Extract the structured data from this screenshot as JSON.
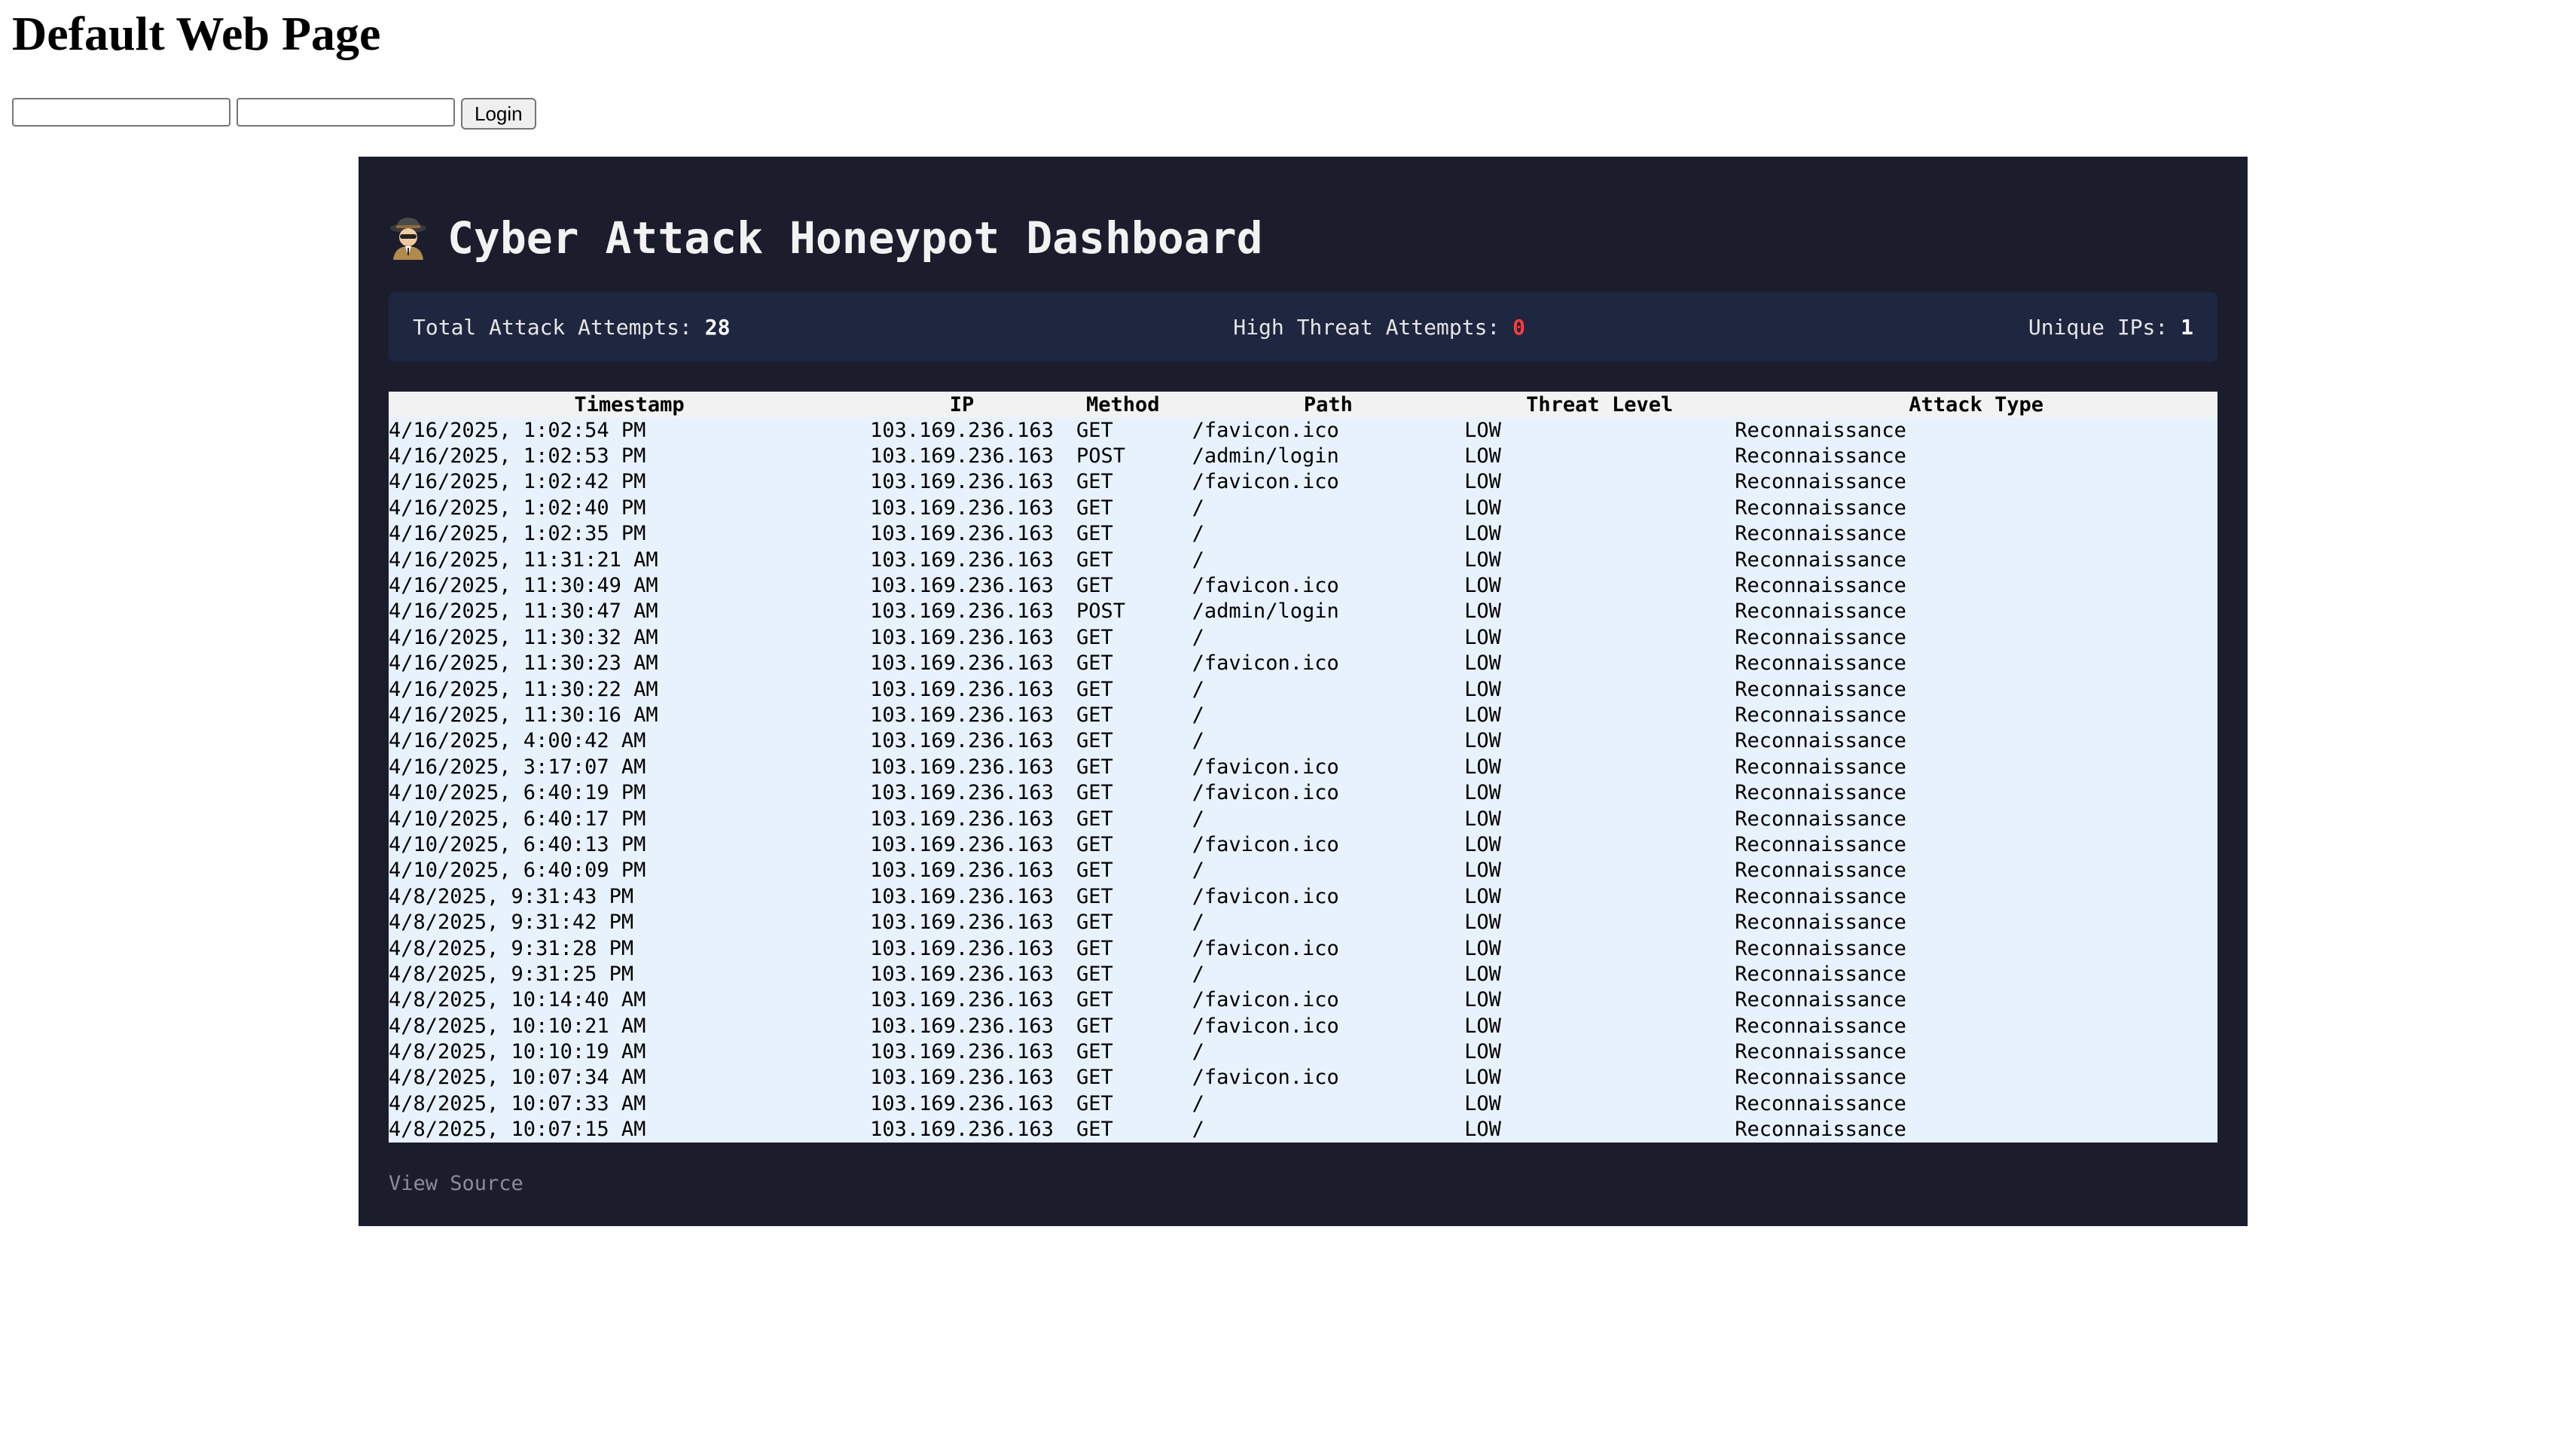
{
  "page": {
    "heading": "Default Web Page",
    "login": {
      "username_value": "",
      "password_value": "",
      "button_label": "Login"
    }
  },
  "dashboard": {
    "title": "Cyber Attack Honeypot Dashboard",
    "title_icon": "spy-icon",
    "stats": {
      "total_label": "Total Attack Attempts:",
      "total_value": "28",
      "high_label": "High Threat Attempts:",
      "high_value": "0",
      "unique_label": "Unique IPs:",
      "unique_value": "1"
    },
    "columns": [
      "Timestamp",
      "IP",
      "Method",
      "Path",
      "Threat Level",
      "Attack Type"
    ],
    "rows": [
      [
        "4/16/2025, 1:02:54 PM",
        "103.169.236.163",
        "GET",
        "/favicon.ico",
        "LOW",
        "Reconnaissance"
      ],
      [
        "4/16/2025, 1:02:53 PM",
        "103.169.236.163",
        "POST",
        "/admin/login",
        "LOW",
        "Reconnaissance"
      ],
      [
        "4/16/2025, 1:02:42 PM",
        "103.169.236.163",
        "GET",
        "/favicon.ico",
        "LOW",
        "Reconnaissance"
      ],
      [
        "4/16/2025, 1:02:40 PM",
        "103.169.236.163",
        "GET",
        "/",
        "LOW",
        "Reconnaissance"
      ],
      [
        "4/16/2025, 1:02:35 PM",
        "103.169.236.163",
        "GET",
        "/",
        "LOW",
        "Reconnaissance"
      ],
      [
        "4/16/2025, 11:31:21 AM",
        "103.169.236.163",
        "GET",
        "/",
        "LOW",
        "Reconnaissance"
      ],
      [
        "4/16/2025, 11:30:49 AM",
        "103.169.236.163",
        "GET",
        "/favicon.ico",
        "LOW",
        "Reconnaissance"
      ],
      [
        "4/16/2025, 11:30:47 AM",
        "103.169.236.163",
        "POST",
        "/admin/login",
        "LOW",
        "Reconnaissance"
      ],
      [
        "4/16/2025, 11:30:32 AM",
        "103.169.236.163",
        "GET",
        "/",
        "LOW",
        "Reconnaissance"
      ],
      [
        "4/16/2025, 11:30:23 AM",
        "103.169.236.163",
        "GET",
        "/favicon.ico",
        "LOW",
        "Reconnaissance"
      ],
      [
        "4/16/2025, 11:30:22 AM",
        "103.169.236.163",
        "GET",
        "/",
        "LOW",
        "Reconnaissance"
      ],
      [
        "4/16/2025, 11:30:16 AM",
        "103.169.236.163",
        "GET",
        "/",
        "LOW",
        "Reconnaissance"
      ],
      [
        "4/16/2025, 4:00:42 AM",
        "103.169.236.163",
        "GET",
        "/",
        "LOW",
        "Reconnaissance"
      ],
      [
        "4/16/2025, 3:17:07 AM",
        "103.169.236.163",
        "GET",
        "/favicon.ico",
        "LOW",
        "Reconnaissance"
      ],
      [
        "4/10/2025, 6:40:19 PM",
        "103.169.236.163",
        "GET",
        "/favicon.ico",
        "LOW",
        "Reconnaissance"
      ],
      [
        "4/10/2025, 6:40:17 PM",
        "103.169.236.163",
        "GET",
        "/",
        "LOW",
        "Reconnaissance"
      ],
      [
        "4/10/2025, 6:40:13 PM",
        "103.169.236.163",
        "GET",
        "/favicon.ico",
        "LOW",
        "Reconnaissance"
      ],
      [
        "4/10/2025, 6:40:09 PM",
        "103.169.236.163",
        "GET",
        "/",
        "LOW",
        "Reconnaissance"
      ],
      [
        "4/8/2025, 9:31:43 PM",
        "103.169.236.163",
        "GET",
        "/favicon.ico",
        "LOW",
        "Reconnaissance"
      ],
      [
        "4/8/2025, 9:31:42 PM",
        "103.169.236.163",
        "GET",
        "/",
        "LOW",
        "Reconnaissance"
      ],
      [
        "4/8/2025, 9:31:28 PM",
        "103.169.236.163",
        "GET",
        "/favicon.ico",
        "LOW",
        "Reconnaissance"
      ],
      [
        "4/8/2025, 9:31:25 PM",
        "103.169.236.163",
        "GET",
        "/",
        "LOW",
        "Reconnaissance"
      ],
      [
        "4/8/2025, 10:14:40 AM",
        "103.169.236.163",
        "GET",
        "/favicon.ico",
        "LOW",
        "Reconnaissance"
      ],
      [
        "4/8/2025, 10:10:21 AM",
        "103.169.236.163",
        "GET",
        "/favicon.ico",
        "LOW",
        "Reconnaissance"
      ],
      [
        "4/8/2025, 10:10:19 AM",
        "103.169.236.163",
        "GET",
        "/",
        "LOW",
        "Reconnaissance"
      ],
      [
        "4/8/2025, 10:07:34 AM",
        "103.169.236.163",
        "GET",
        "/favicon.ico",
        "LOW",
        "Reconnaissance"
      ],
      [
        "4/8/2025, 10:07:33 AM",
        "103.169.236.163",
        "GET",
        "/",
        "LOW",
        "Reconnaissance"
      ],
      [
        "4/8/2025, 10:07:15 AM",
        "103.169.236.163",
        "GET",
        "/",
        "LOW",
        "Reconnaissance"
      ]
    ],
    "footer_link": "View Source"
  },
  "colors": {
    "panel_bg": "#1b1d2d",
    "stats_bg": "#1e2640",
    "danger": "#ff3b3b",
    "row_bg": "#e8f2fc",
    "header_bg": "#f2f2f2"
  }
}
